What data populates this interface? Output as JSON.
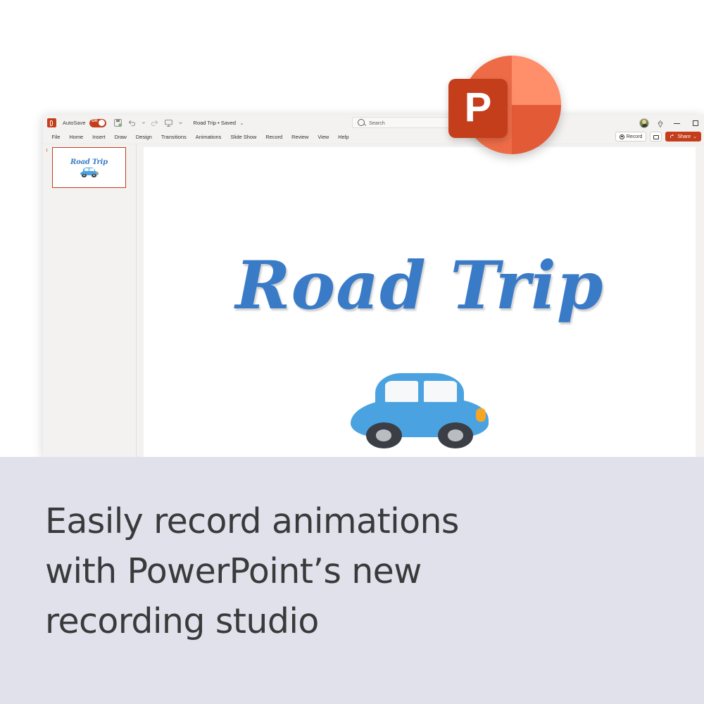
{
  "app": {
    "title_bar": {
      "logo_icon": "powerpoint-mini-logo",
      "autosave_label": "AutoSave",
      "autosave_state": "On",
      "document_title": "Road Trip • Saved",
      "title_chevron": "⌄",
      "quick_access": [
        {
          "name": "save-icon",
          "glyph": "save"
        },
        {
          "name": "undo-icon",
          "glyph": "undo"
        },
        {
          "name": "undo-dropdown-icon",
          "glyph": "⌄"
        },
        {
          "name": "redo-icon",
          "glyph": "redo"
        },
        {
          "name": "present-icon",
          "glyph": "present"
        },
        {
          "name": "qat-overflow-icon",
          "glyph": "⌄"
        }
      ],
      "search_placeholder": "Search",
      "search_icon": "search-icon",
      "avatar": "user-avatar",
      "copilot_icon": "diamond-icon",
      "window_controls": [
        "minimize",
        "maximize"
      ]
    },
    "ribbon": {
      "tabs": [
        "File",
        "Home",
        "Insert",
        "Draw",
        "Design",
        "Transitions",
        "Animations",
        "Slide Show",
        "Record",
        "Review",
        "View",
        "Help"
      ],
      "record_button": "Record",
      "comments_button": "comment-icon",
      "share_button": "Share",
      "share_chevron": "⌄"
    },
    "thumbnail_pane": {
      "slides": [
        {
          "number": "1",
          "title": "Road Trip",
          "has_car_image": true,
          "selected": true
        }
      ]
    },
    "slide": {
      "title": "Road Trip",
      "title_color": "#3a7bc8",
      "car_emoji": "car-illustration"
    }
  },
  "logo": {
    "letter": "P",
    "colors": {
      "square": "#c43e1c",
      "circle": "#ed6c47",
      "circle_light": "#ff8f6b",
      "circle_dark": "#e25b36"
    }
  },
  "caption": {
    "text": "Easily record animations\nwith PowerPoint’s new\nrecording studio",
    "background": "#e0e1ea",
    "text_color": "#3a3a3c"
  }
}
